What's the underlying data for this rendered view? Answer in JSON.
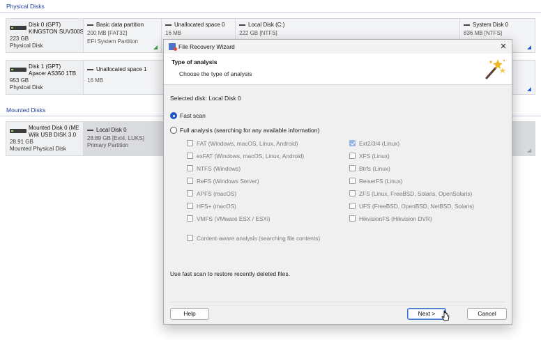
{
  "sections": {
    "physical": "Physical Disks",
    "mounted": "Mounted Disks"
  },
  "disk0": {
    "name_line1": "Disk 0 (GPT)",
    "name_line2": "KINGSTON SUV300S",
    "size": "223 GB",
    "kind": "Physical Disk",
    "partitions": [
      {
        "title": "Basic data partition",
        "line1": "200 MB [FAT32]",
        "line2": "EFI System Partition"
      },
      {
        "title": "Unallocated space 0",
        "line1": "16 MB",
        "line2": ""
      },
      {
        "title": "Local Disk (C:)",
        "line1": "222 GB [NTFS]",
        "line2": ""
      },
      {
        "title": "System Disk 0",
        "line1": "836 MB [NTFS]",
        "line2": ""
      }
    ]
  },
  "disk1": {
    "name_line1": "Disk 1 (GPT)",
    "name_line2": "Apacer AS350 1TB",
    "size": "953 GB",
    "kind": "Physical Disk",
    "partitions": [
      {
        "title": "Unallocated space 1",
        "line1": "16 MB",
        "line2": ""
      }
    ]
  },
  "mounted0": {
    "name_line1": "Mounted Disk 0 (ME",
    "name_line2": "Wilk USB DISK 3.0",
    "size": "28.91 GB",
    "kind": "Mounted Physical Disk",
    "partitions": [
      {
        "title": "Local Disk 0",
        "line1": "28.89 GB [Ext4, LUKS]",
        "line2": "Primary Partition"
      }
    ]
  },
  "dialog": {
    "title": "File Recovery Wizard",
    "close": "✕",
    "heading": "Type of analysis",
    "subheading": "Choose the type of analysis",
    "selected_disk": "Selected disk: Local Disk 0",
    "fast_scan": "Fast scan",
    "full_analysis": "Full analysis (searching for any available information)",
    "fs_left": [
      "FAT (Windows, macOS, Linux, Android)",
      "exFAT (Windows, macOS, Linux, Android)",
      "NTFS (Windows)",
      "ReFS (Windows Server)",
      "APFS (macOS)",
      "HFS+ (macOS)",
      "VMFS (VMware ESX / ESXi)"
    ],
    "fs_right": [
      "Ext2/3/4 (Linux)",
      "XFS (Linux)",
      "Btrfs (Linux)",
      "ReiserFS (Linux)",
      "ZFS (Linux, FreeBSD, Solaris, OpenSolaris)",
      "UFS (FreeBSD, OpenBSD, NetBSD, Solaris)",
      "HikvisionFS (Hikvision DVR)"
    ],
    "content_aware": "Content-aware analysis (searching file contents)",
    "hint": "Use fast scan to restore recently deleted files.",
    "help": "Help",
    "next": "Next >",
    "cancel": "Cancel"
  },
  "state": {
    "fast_scan_selected": true,
    "ext_checked": true
  },
  "colors": {
    "accent": "#1f57c3",
    "section_header": "#1f3f9a"
  }
}
